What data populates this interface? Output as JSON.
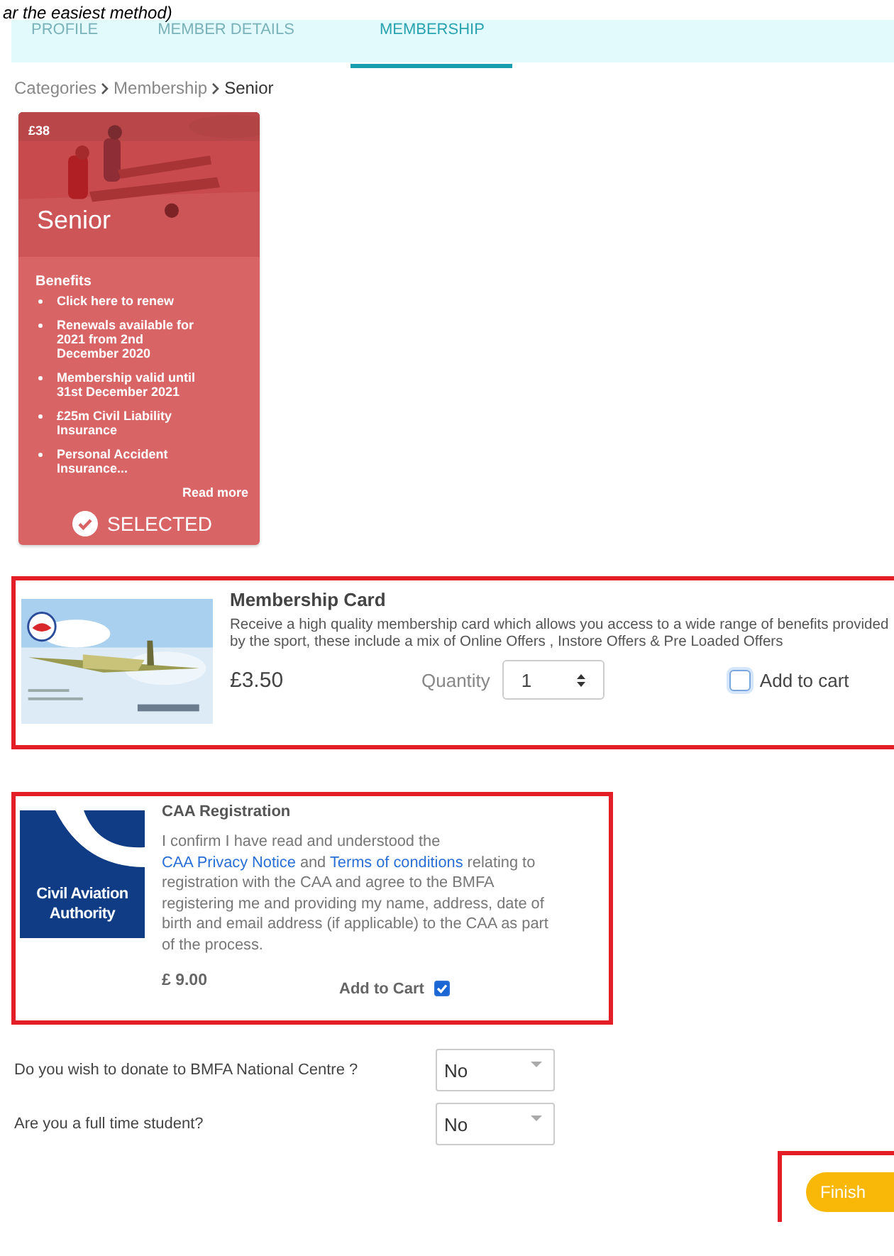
{
  "caption": "ar the easiest method)",
  "tabs": [
    {
      "label": "PROFILE",
      "selected": false
    },
    {
      "label": "MEMBER DETAILS",
      "selected": false
    },
    {
      "label": "MEMBERSHIP",
      "selected": true
    }
  ],
  "breadcrumb": [
    "Categories",
    "Membership",
    "Senior"
  ],
  "category_card": {
    "price": "£38",
    "title": "Senior",
    "benefits_heading": "Benefits",
    "benefits": [
      "Click here to renew",
      "Renewals available for 2021 from 2nd December 2020",
      "Membership valid until 31st December 2021",
      "£25m Civil Liability Insurance",
      "Personal Accident Insurance..."
    ],
    "read_more": "Read more",
    "status": "SELECTED",
    "selected": true
  },
  "membership_card": {
    "title": "Membership Card",
    "description": "Receive a high quality membership card which allows you access to a wide range of benefits provided by the sport, these include a mix of Online Offers , Instore Offers & Pre Loaded Offers",
    "price": "£3.50",
    "quantity_label": "Quantity",
    "quantity": "1",
    "add_label": "Add to cart",
    "checked": false
  },
  "caa": {
    "logo_text": "Civil Aviation Authority",
    "title": "CAA Registration",
    "text_before": "I confirm I have read and understood the",
    "link1": "CAA Privacy Notice",
    "text_mid": "and",
    "link2": "Terms of conditions",
    "text_after": "relating to registration with the CAA and agree to the BMFA registering me and providing my name, address, date of birth and email address (if applicable) to the CAA as part of the process.",
    "price": "£ 9.00",
    "add_label": "Add to Cart",
    "checked": true
  },
  "questions": [
    {
      "label": "Do you wish to donate to BMFA National Centre ?",
      "value": "No"
    },
    {
      "label": "Are you a full time student?",
      "value": "No"
    }
  ],
  "finish": "Finish"
}
